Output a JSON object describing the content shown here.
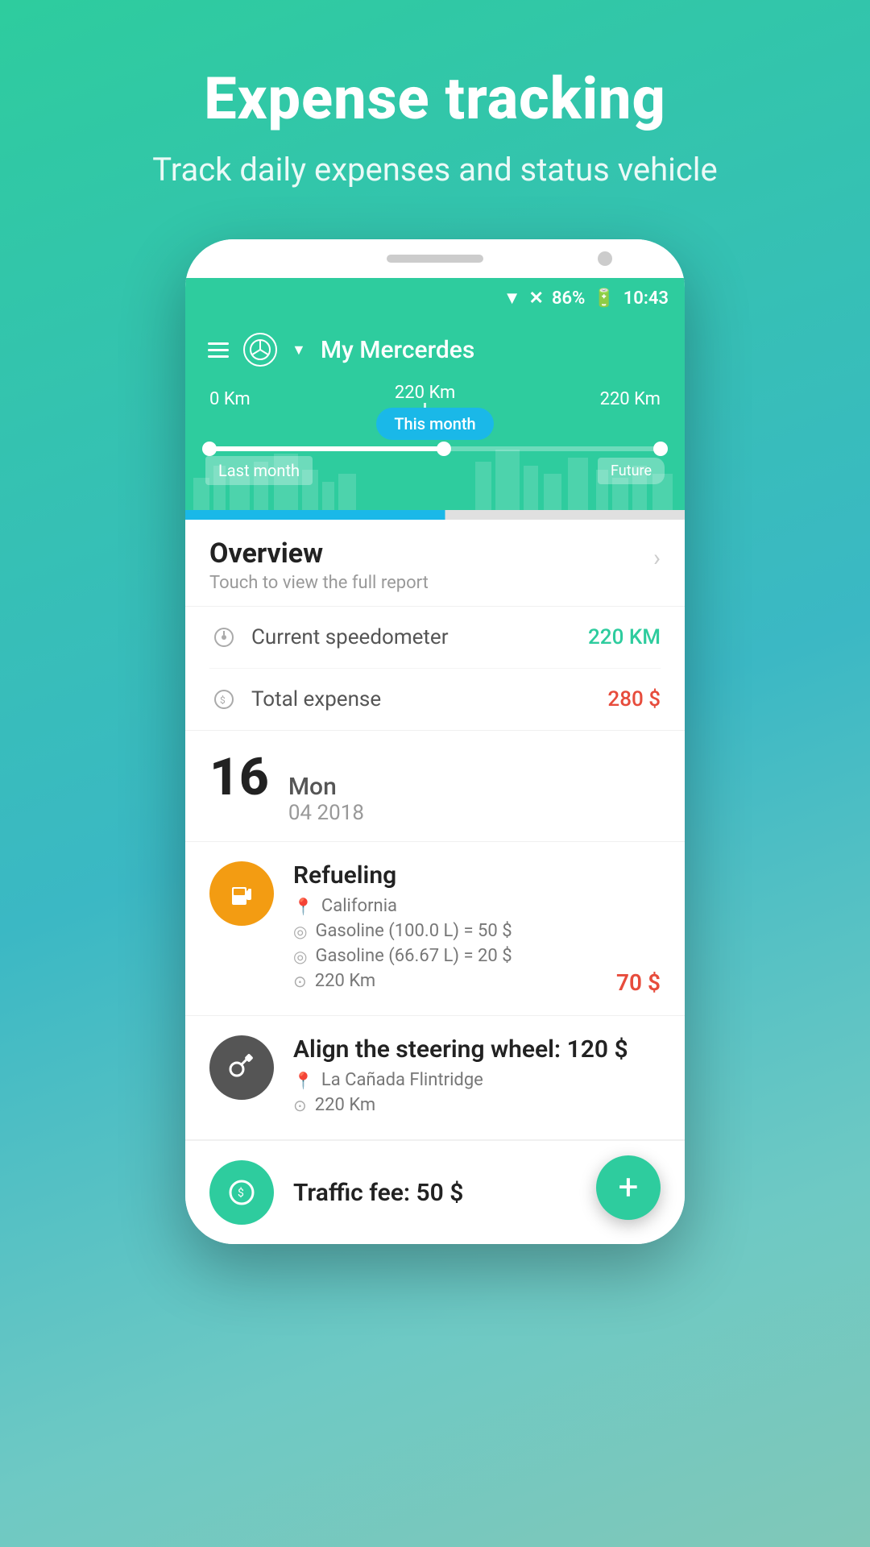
{
  "hero": {
    "title": "Expense tracking",
    "subtitle": "Track daily expenses and status vehicle"
  },
  "status_bar": {
    "battery": "86%",
    "time": "10:43"
  },
  "header": {
    "car_name": "My Mercerdes",
    "menu_icon": "≡"
  },
  "timeline": {
    "left_label": "0 Km",
    "center_label": "220 Km",
    "right_label": "220 Km",
    "last_month": "Last month",
    "this_month": "This month",
    "future": "Future"
  },
  "overview": {
    "title": "Overview",
    "subtitle": "Touch to view the full report"
  },
  "stats": [
    {
      "label": "Current speedometer",
      "value": "220 KM",
      "type": "green"
    },
    {
      "label": "Total expense",
      "value": "280 $",
      "type": "red"
    }
  ],
  "date": {
    "day": "16",
    "weekday": "Mon",
    "month_year": "04 2018"
  },
  "transactions": [
    {
      "id": 1,
      "icon_type": "fuel",
      "icon_char": "⛽",
      "title": "Refueling",
      "location": "California",
      "details": [
        "Gasoline (100.0 L) = 50 $",
        "Gasoline (66.67 L) = 20 $"
      ],
      "km": "220 Km",
      "amount": "70 $"
    },
    {
      "id": 2,
      "icon_type": "service",
      "icon_char": "🔧",
      "title": "Align the steering wheel: 120 $",
      "location": "La Cañada Flintridge",
      "km": "220 Km",
      "amount": ""
    }
  ],
  "last_item": {
    "title": "Traffic fee: 50 $"
  },
  "fab": {
    "label": "+"
  }
}
